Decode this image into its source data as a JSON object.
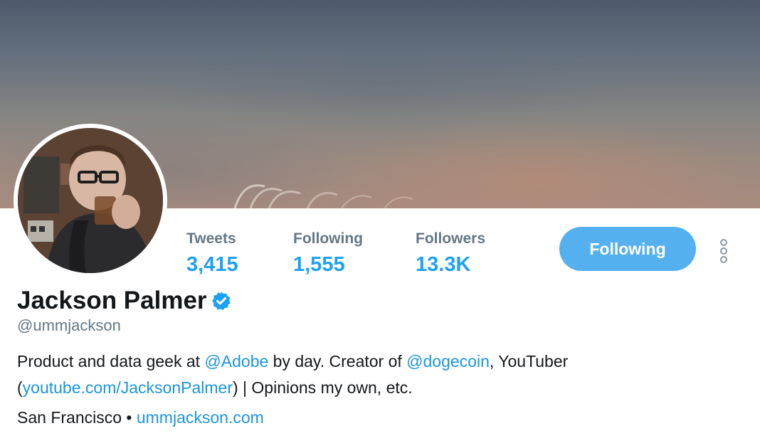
{
  "profile": {
    "name": "Jackson Palmer",
    "handle": "@ummjackson",
    "verified": true
  },
  "stats": {
    "tweets_label": "Tweets",
    "tweets_value": "3,415",
    "following_label": "Following",
    "following_value": "1,555",
    "followers_label": "Followers",
    "followers_value": "13.3K"
  },
  "actions": {
    "follow_label": "Following",
    "more_icon": "more-vertical-icon"
  },
  "bio": {
    "part1": "Product and data geek at ",
    "mention_adobe": "@Adobe",
    "part2": " by day. Creator of ",
    "mention_dogecoin": "@dogecoin",
    "part3": ", YouTuber",
    "paren_open": "(",
    "youtube_link": "youtube.com/JacksonPalmer",
    "part4": ") | Opinions my own, etc."
  },
  "meta": {
    "location": "San Francisco",
    "separator": " • ",
    "website": "ummjackson.com"
  },
  "colors": {
    "accent": "#1da1f2",
    "link": "#1b95e0",
    "button_bg": "#55b0ef",
    "muted": "#657786"
  }
}
